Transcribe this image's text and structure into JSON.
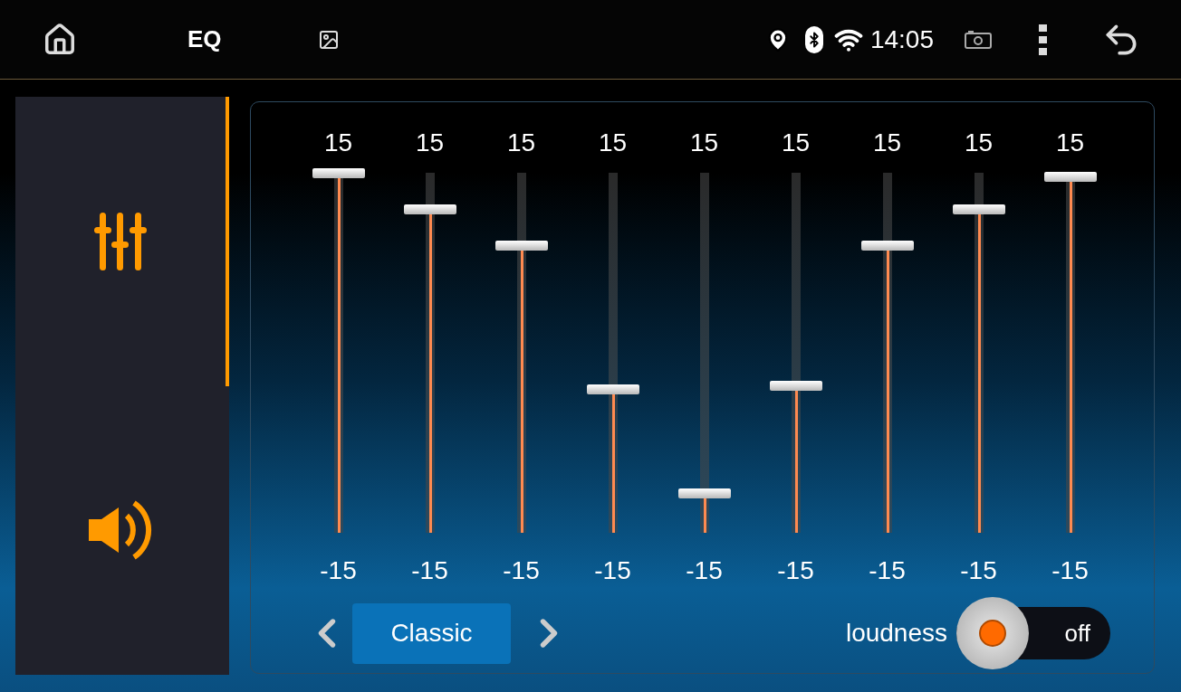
{
  "status_bar": {
    "title": "EQ",
    "time": "14:05"
  },
  "sidebar": {
    "tabs": [
      {
        "kind": "equalizer",
        "selected": true
      },
      {
        "kind": "volume",
        "selected": false
      }
    ]
  },
  "equalizer": {
    "bands": [
      {
        "max_label": "15",
        "min_label": "-15",
        "level": 1.0
      },
      {
        "max_label": "15",
        "min_label": "-15",
        "level": 0.9
      },
      {
        "max_label": "15",
        "min_label": "-15",
        "level": 0.8
      },
      {
        "max_label": "15",
        "min_label": "-15",
        "level": 0.4
      },
      {
        "max_label": "15",
        "min_label": "-15",
        "level": 0.11
      },
      {
        "max_label": "15",
        "min_label": "-15",
        "level": 0.41
      },
      {
        "max_label": "15",
        "min_label": "-15",
        "level": 0.8
      },
      {
        "max_label": "15",
        "min_label": "-15",
        "level": 0.9
      },
      {
        "max_label": "15",
        "min_label": "-15",
        "level": 0.99
      }
    ],
    "preset": "Classic",
    "loudness": {
      "label": "loudness",
      "on": false,
      "state_label": "off"
    }
  }
}
